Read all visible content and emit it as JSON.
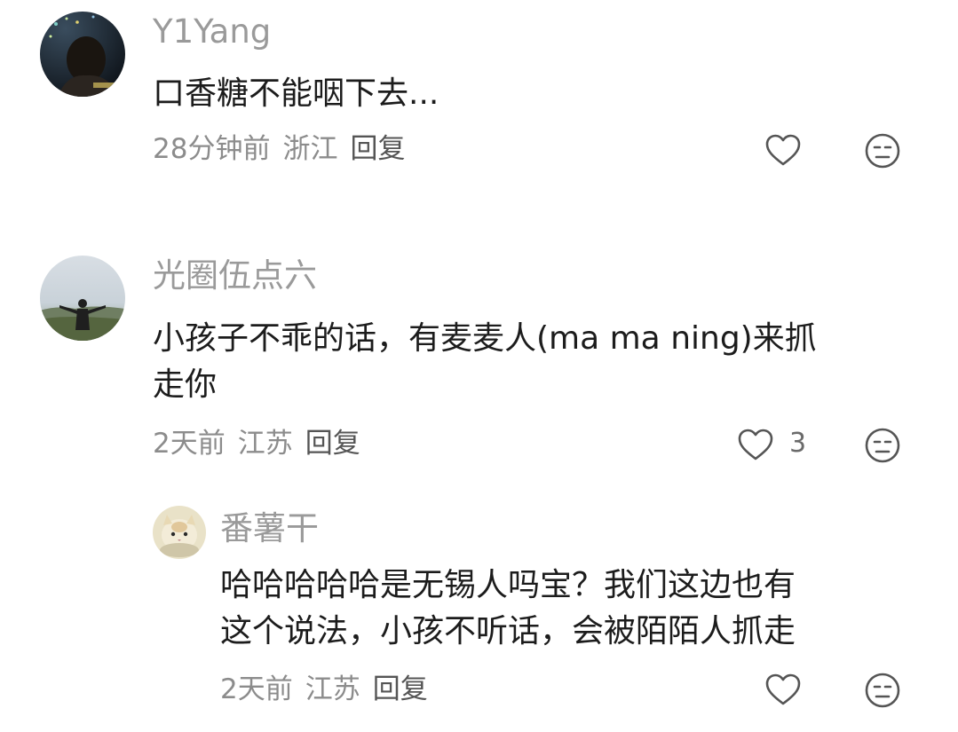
{
  "comments": [
    {
      "username": "Y1Yang",
      "content_lines": [
        "口香糖不能咽下去..."
      ],
      "time": "28分钟前",
      "location": "浙江",
      "reply_label": "回复",
      "like_count": "",
      "like_icon": "heart-outline-icon",
      "dislike_icon": "unamused-face-icon"
    },
    {
      "username": "光圈伍点六",
      "content_lines": [
        "小孩子不乖的话，有麦麦人(ma ma ning)来抓",
        "走你"
      ],
      "time": "2天前",
      "location": "江苏",
      "reply_label": "回复",
      "like_count": "3",
      "like_icon": "heart-outline-icon",
      "dislike_icon": "unamused-face-icon",
      "replies": [
        {
          "username": "番薯干",
          "content_lines": [
            "哈哈哈哈哈是无锡人吗宝？我们这边也有",
            "这个说法，小孩不听话，会被陌陌人抓走"
          ],
          "time": "2天前",
          "location": "江苏",
          "reply_label": "回复",
          "like_count": "",
          "like_icon": "heart-outline-icon",
          "dislike_icon": "unamused-face-icon"
        }
      ]
    }
  ],
  "colors": {
    "username": "#9a9a9a",
    "content": "#1c1c1c",
    "meta": "#8c8c8c",
    "icon": "#555555"
  }
}
